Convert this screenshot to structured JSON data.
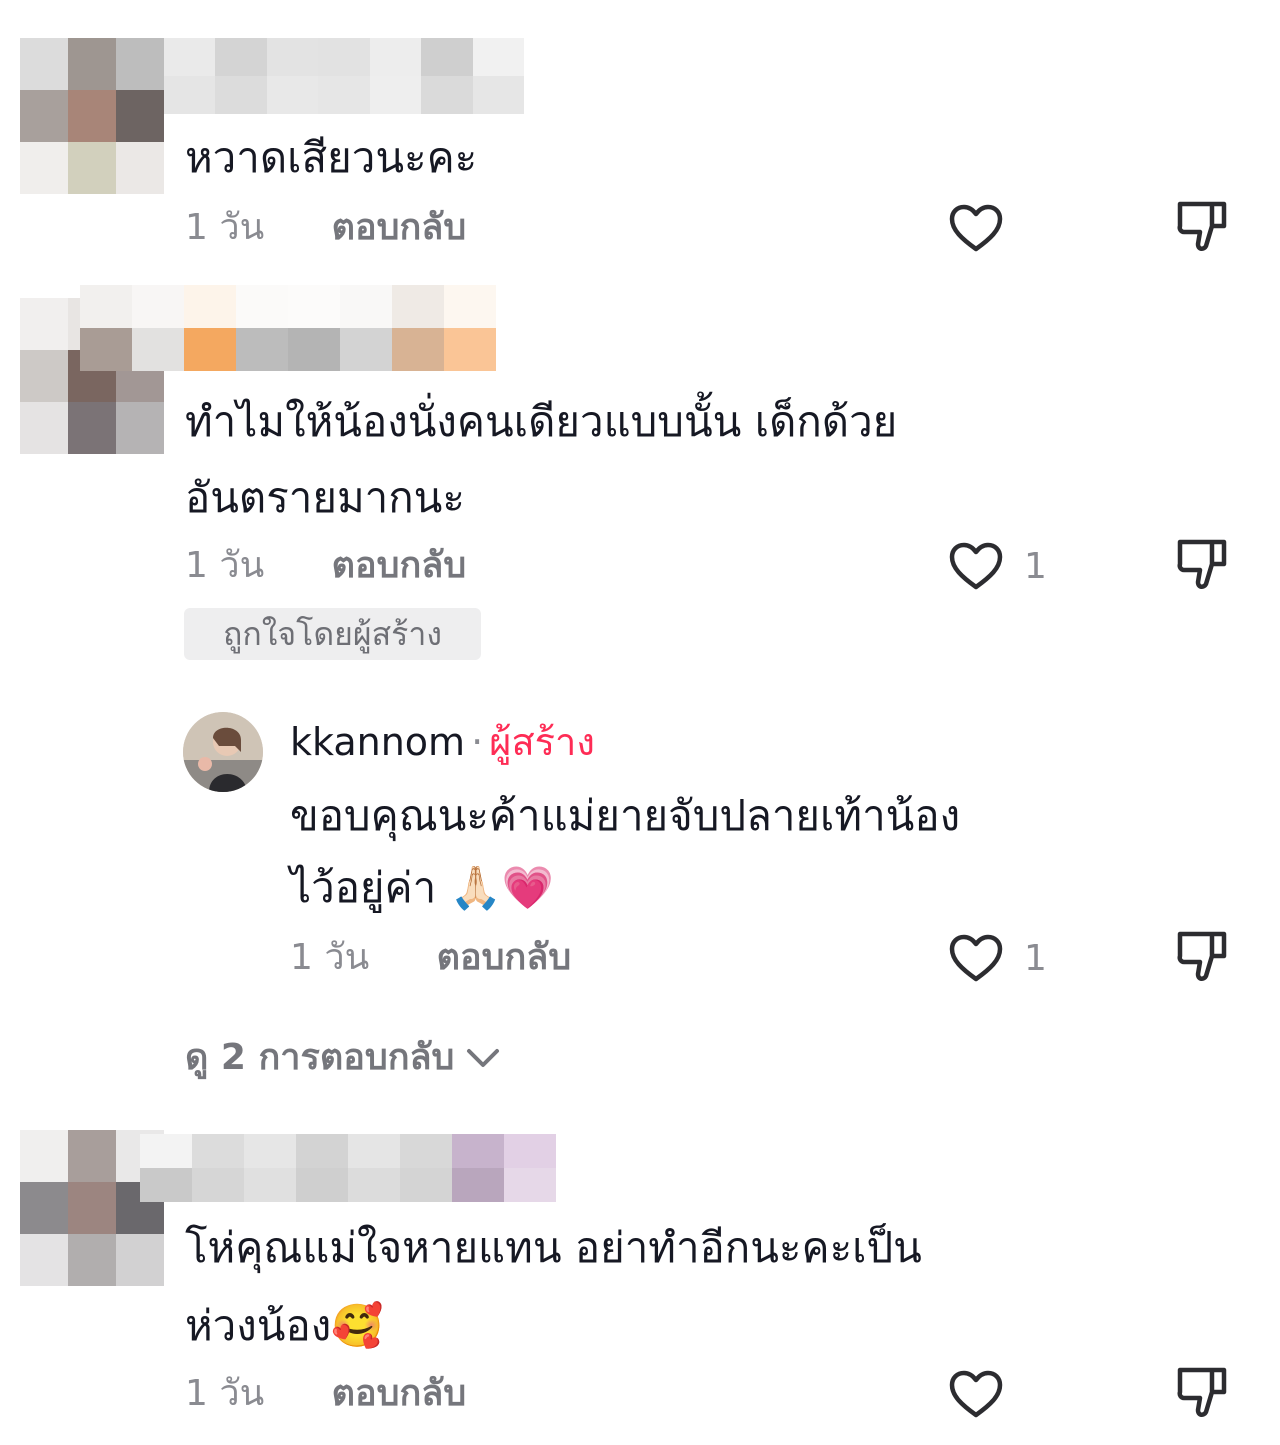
{
  "comments": [
    {
      "text_lines": [
        "หวาดเสียวนะคะ"
      ],
      "time": "1 วัน",
      "reply_label": "ตอบกลับ",
      "like_count": ""
    },
    {
      "text_lines": [
        "ทำไมให้น้องนั่งคนเดียวแบบนั้น เด็กด้วย",
        "อันตรายมากนะ"
      ],
      "time": "1 วัน",
      "reply_label": "ตอบกลับ",
      "like_count": "1",
      "badge": "ถูกใจโดยผู้สร้าง"
    },
    {
      "text_lines": [
        "โห่คุณแม่ใจหายแทน อย่าทำอีกนะคะเป็น",
        "ห่วงน้อง🥰"
      ],
      "time": "1 วัน",
      "reply_label": "ตอบกลับ",
      "like_count": ""
    }
  ],
  "reply": {
    "username": "kkannom",
    "separator": "·",
    "creator_label": "ผู้สร้าง",
    "text_lines": [
      "ขอบคุณนะค้าแม่ยายจับปลายเท้าน้อง",
      "ไว้อยู่ค่า 🙏🏻💗"
    ],
    "time": "1 วัน",
    "reply_label": "ตอบกลับ",
    "like_count": "1"
  },
  "view_more": "ดู 2 การตอบกลับ",
  "colors": {
    "text": "#161823",
    "meta": "#8a8b91",
    "creator": "#fe2c55",
    "badge_bg": "#eeeeef"
  },
  "icons": [
    "heart-outline-icon",
    "dislike-icon",
    "chevron-down-icon"
  ]
}
